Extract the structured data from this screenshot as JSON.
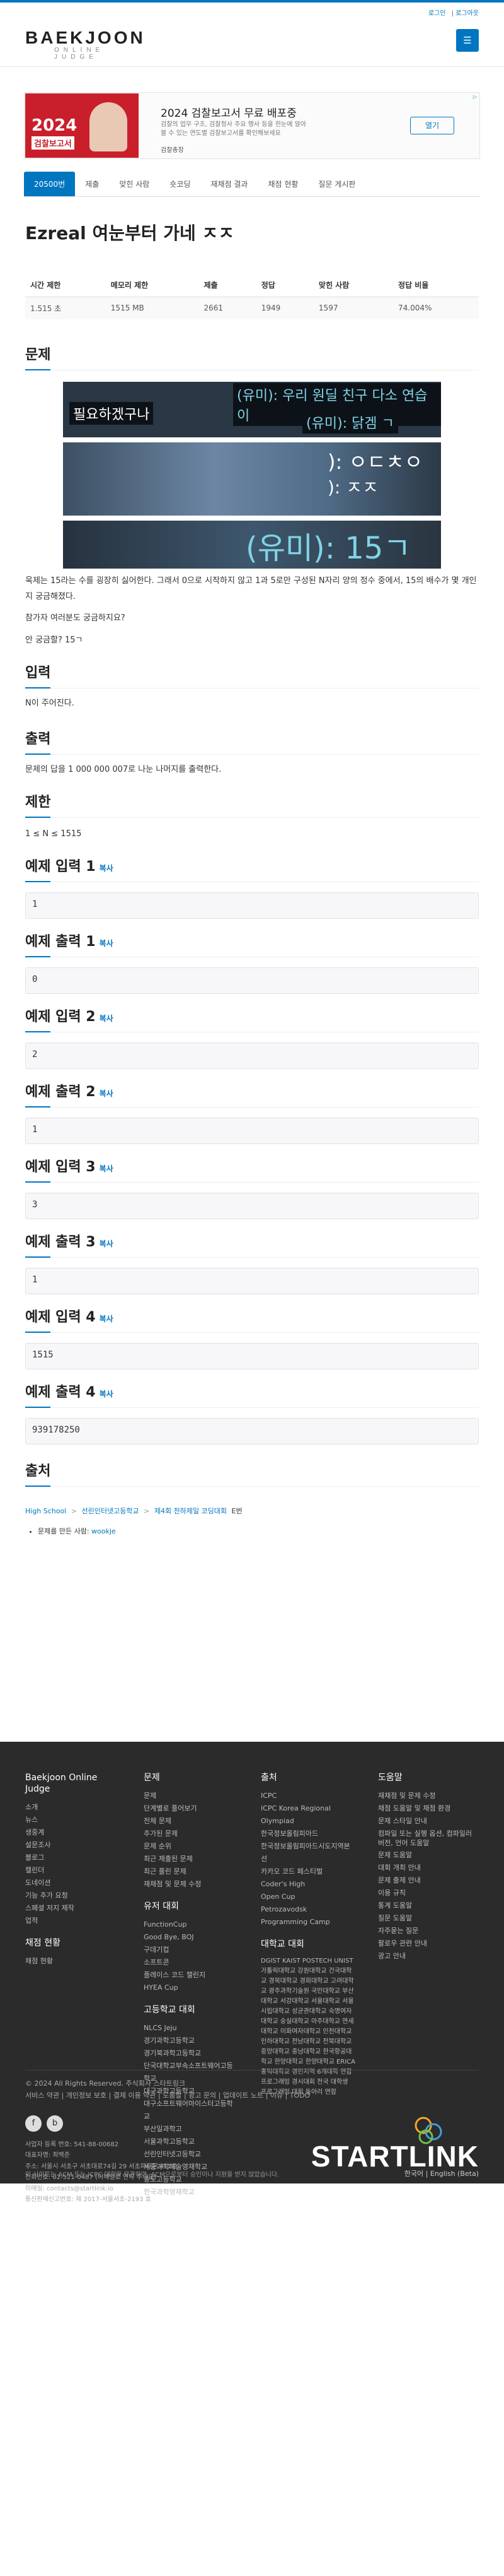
{
  "colors": {
    "accent": "#0076c0",
    "footer_bg": "#2b2b2b",
    "ad_red": "#c91f2b"
  },
  "top_links": {
    "settings": "로그인",
    "login": "로그아웃",
    "divider": "|"
  },
  "logo": {
    "main": "BAEKJOON",
    "sub": "ONLINE JUDGE"
  },
  "menu_icon": "hamburger-icon",
  "ad": {
    "image_big": "2024",
    "image_small": "검찰보고서",
    "title": "2024 검찰보고서 무료 배포중",
    "desc": "검찰의 업무 구조, 검찰청사 주요 행사 등을 한눈에 알아볼 수 있는 연도별 검찰보고서를 확인해보세요",
    "brand": "검찰총장",
    "button": "열기",
    "mark": "▷"
  },
  "tabs": [
    "20500번",
    "제출",
    "맞힌 사람",
    "숏코딩",
    "재채점 결과",
    "채점 현황",
    "질문 게시판"
  ],
  "problem": {
    "title": "Ezreal 여눈부터 가네 ㅈㅈ",
    "info_headers": [
      "시간 제한",
      "메모리 제한",
      "제출",
      "정답",
      "맞힌 사람",
      "정답 비율"
    ],
    "info_values": [
      "1.515 초",
      "1515 MB",
      "2661",
      "1949",
      "1597",
      "74.004%"
    ]
  },
  "sections": {
    "problem": "문제",
    "input": "입력",
    "output": "출력",
    "limit": "제한",
    "source": "출처"
  },
  "comic": {
    "p1_line1": "(유미): 우리 원딜 친구 다소 연습이",
    "p1_line2": "필요하겠구나",
    "p1_line3": "(유미): 닭겜 ㄱ",
    "p2_line1": "): ㅇㄷㅊㅇ",
    "p2_line2": "): ㅈㅈ",
    "p3_line": "(유미): 15ㄱ"
  },
  "problem_text": [
    "욱제는 15라는 수를 굉장히 싫어한다. 그래서 0으로 시작하지 않고 1과 5로만 구성된 N자리 양의 정수 중에서, 15의 배수가 몇 개인지 궁금해졌다.",
    "참가자 여러분도 궁금하지요?",
    "안 궁금할? 15ㄱ"
  ],
  "input_text": "N이 주어진다.",
  "output_text": "문제의 답을 1 000 000 007로 나눈 나머지를 출력한다.",
  "limit_text": "1 ≤ N ≤ 1515",
  "copy_label": "복사",
  "samples": [
    {
      "label": "예제 입력 1",
      "value": "1"
    },
    {
      "label": "예제 출력 1",
      "value": "0"
    },
    {
      "label": "예제 입력 2",
      "value": "2"
    },
    {
      "label": "예제 출력 2",
      "value": "1"
    },
    {
      "label": "예제 입력 3",
      "value": "3"
    },
    {
      "label": "예제 출력 3",
      "value": "1"
    },
    {
      "label": "예제 입력 4",
      "value": "1515"
    },
    {
      "label": "예제 출력 4",
      "value": "939178250"
    }
  ],
  "source": {
    "crumb1": "High School",
    "crumb2": "선린인터넷고등학교",
    "crumb3": "제4회 천하제일 코딩대회",
    "crumb4": "E번",
    "sep": ">",
    "author_prefix": "문제를 만든 사람:",
    "author": "wookje"
  },
  "footer": {
    "col1": {
      "title": "Baekjoon Online Judge",
      "items": [
        "소개",
        "뉴스",
        "생중계",
        "설문조사",
        "블로그",
        "캘린더",
        "도네이션",
        "기능 추가 요청",
        "스페셜 저지 제작",
        "업적"
      ],
      "sub_title": "채점 현황",
      "sub_items": [
        "채점 현황"
      ]
    },
    "col2": {
      "title": "문제",
      "items": [
        "문제",
        "단계별로 풀어보기",
        "전체 문제",
        "추가된 문제",
        "문제 순위",
        "최근 제출된 문제",
        "최근 풀린 문제",
        "재채점 및 문제 수정"
      ],
      "sub_title": "유저 대회",
      "sub_items": [
        "FunctionCup",
        "Good Bye, BOJ",
        "구데기컵",
        "소프트콘",
        "플레이스 코드 챌린지",
        "HYEA Cup"
      ],
      "sub2_title": "고등학교 대회",
      "sub2_items": [
        "NLCS Jeju",
        "경기과학고등학교",
        "경기북과학고등학교",
        "단국대학교부속소프트웨어고등학교",
        "대구과학고등학교",
        "대구소프트웨어마이스터고등학교",
        "부산일과학고",
        "서울과학고등학교",
        "선린인터넷고등학교",
        "세종과학예술영재학교",
        "송도고등학교",
        "한국과학영재학교"
      ]
    },
    "col3": {
      "title": "출처",
      "items": [
        "ICPC",
        "ICPC Korea Regional",
        "Olympiad",
        "한국정보올림피아드",
        "한국정보올림피아드시도지역본선",
        "카카오 코드 페스티벌",
        "Coder's High",
        "Open Cup",
        "Petrozavodsk",
        "Programming Camp"
      ],
      "sub_title": "대학교 대회",
      "sub_items": [
        "DGIST",
        "KAIST",
        "POSTECH",
        "UNIST",
        "가톨릭대학교",
        "강원대학교",
        "건국대학교",
        "경북대학교",
        "경희대학교",
        "고려대학교",
        "광주과학기술원",
        "국민대학교",
        "부산대학교",
        "서강대학교",
        "서울대학교",
        "서울시립대학교",
        "성균관대학교",
        "숙명여자대학교",
        "숭실대학교",
        "아주대학교",
        "연세대학교",
        "이화여자대학교",
        "인천대학교",
        "인하대학교",
        "전남대학교",
        "전북대학교",
        "중앙대학교",
        "충남대학교",
        "한국항공대학교",
        "한양대학교",
        "한양대학교 ERICA",
        "홍익대학교",
        "경인지역 6개대학 연합 프로그래밍 경시대회",
        "전국 대학생 프로그래밍 대회 동아리 연합"
      ]
    },
    "col4": {
      "title": "도움말",
      "items": [
        "재채점 및 문제 수정",
        "채점 도움말 및 채점 환경",
        "문제 스타일 안내",
        "컴파일 또는 실행 옵션, 컴파일러 버전, 언어 도움말",
        "문제 도움말",
        "대회 개최 안내",
        "문제 출제 안내",
        "이용 규칙",
        "통계 도움말",
        "질문 도움말",
        "자주묻는 질문",
        "팔로우 관련 안내",
        "광고 안내"
      ]
    }
  },
  "footer_bottom": {
    "copyright": "© 2024 All Rights Reserved. 주식회사 스타트링크",
    "links": "서비스 약관 | 개인정보 보호 | 결제 이용 약관 | 도움말 | 광고 문의 | 업데이트 노트 | 이슈 | TODO"
  },
  "social": {
    "facebook": "f",
    "blog": "b"
  },
  "biz": [
    "사업자 등록 번호: 541-88-00682",
    "대표자명: 최백준",
    "주소: 서울시 서초구 서초대로74길 29 서초파라곤 412호",
    "전화번호: 02-521-0487 (이메일로 연락 주세요)",
    "이메일: contacts@startlink.io",
    "통신판매신고번호: 제 2017-서울서초-2193 호"
  ],
  "startlink": "STARTLINK",
  "bottom_note": "이 사이트는 ACM 또는 ICPC 대회와 무관하며, ACM으로부터 승인이나 지원을 받지 않았습니다.",
  "lang": "한국어 | English (Beta)"
}
